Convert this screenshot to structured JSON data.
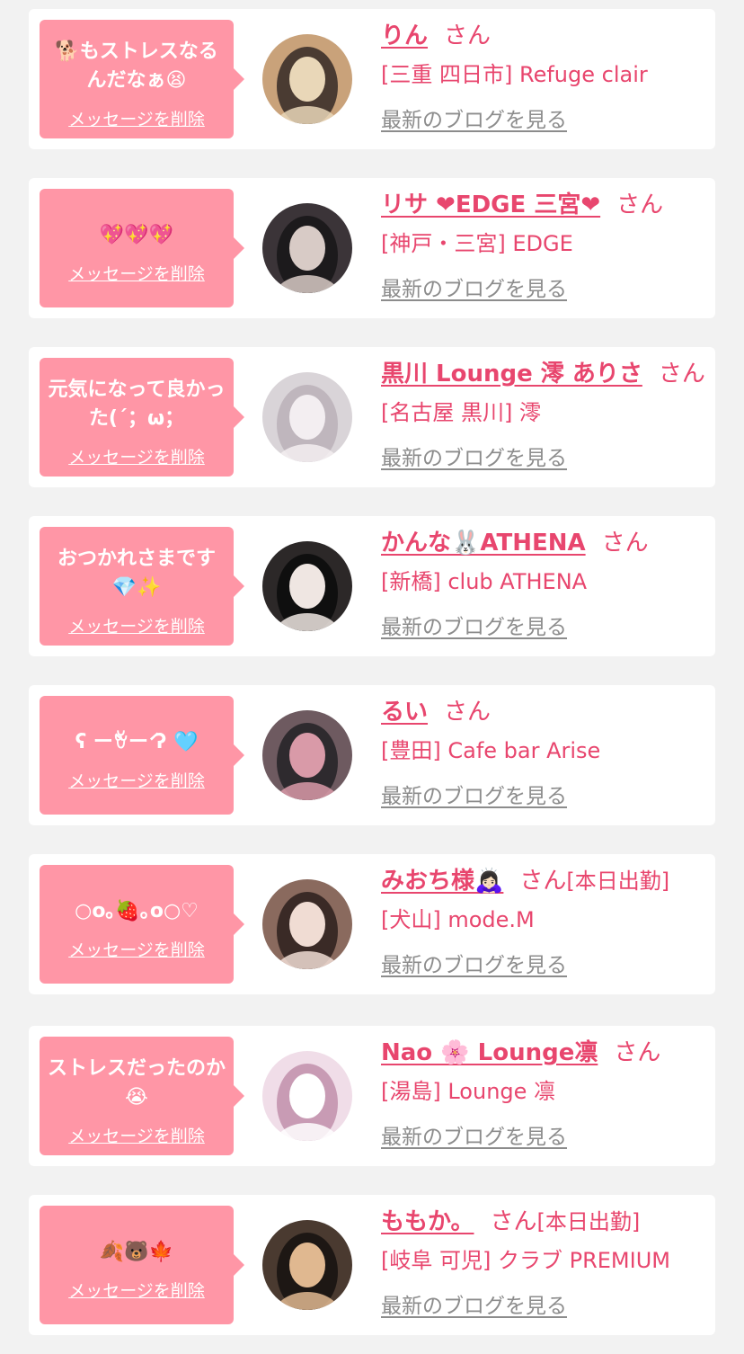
{
  "delete_label": "メッセージを削除",
  "san_label": "さん",
  "blog_label": "最新のブログを見る",
  "colors": {
    "accent": "#e8466e",
    "bubble": "#ff96a6",
    "card": "#ffffff",
    "background": "#f2f2f2",
    "link_gray": "#8c8c8c"
  },
  "items": [
    {
      "message": "🐕もストレスなるんだなぁ😫",
      "name": "りん",
      "status": "",
      "shop": "[三重 四日市] Refuge clair",
      "avatar": {
        "c1": "#c9a27a",
        "c2": "#4a3b32",
        "c3": "#e9d7b8"
      }
    },
    {
      "message": "💖💖💖",
      "name": "リサ ❤EDGE 三宮❤",
      "status": "",
      "shop": "[神戸・三宮] EDGE",
      "avatar": {
        "c1": "#3b3438",
        "c2": "#1c1a1c",
        "c3": "#d8cbc6"
      }
    },
    {
      "message": "元気になって良かった(´；ω；",
      "name": "黒川 Lounge 澪 ありさ",
      "status": "",
      "shop": "[名古屋 黒川] 澪",
      "avatar": {
        "c1": "#d9d4d8",
        "c2": "#bfb6bd",
        "c3": "#f3eef1"
      }
    },
    {
      "message": "おつかれさまです💎✨",
      "name": "かんな🐰ATHENA",
      "status": "",
      "shop": "[新橋] club ATHENA",
      "avatar": {
        "c1": "#2c2828",
        "c2": "#0f0f0f",
        "c3": "#efe6e2"
      }
    },
    {
      "message": "ʕ ー̀ꈊー́ ʔ 🩵",
      "name": "るい",
      "status": "",
      "shop": "[豊田] Cafe bar Arise",
      "avatar": {
        "c1": "#6e5a60",
        "c2": "#2e2a2e",
        "c3": "#d99aa8"
      }
    },
    {
      "message": "○o｡🍓｡o○♡",
      "name": "みおち様🙇🏻‍♀️",
      "status": "[本日出勤]",
      "shop": "[犬山] mode.M",
      "avatar": {
        "c1": "#8a6a5e",
        "c2": "#3a2a26",
        "c3": "#f0dcd3"
      }
    },
    {
      "message": "ストレスだったのか😭",
      "name": "Nao 🌸 Lounge凛",
      "status": "",
      "shop": "[湯島] Lounge 凛",
      "avatar": {
        "c1": "#f0dde8",
        "c2": "#c89bb4",
        "c3": "#ffffff"
      }
    },
    {
      "message": "🍂🐻🍁",
      "name": "ももか。",
      "status": "[本日出勤]",
      "shop": "[岐阜 可児] クラブ PREMIUM",
      "avatar": {
        "c1": "#4a3a30",
        "c2": "#1d1714",
        "c3": "#e0b890"
      }
    }
  ]
}
